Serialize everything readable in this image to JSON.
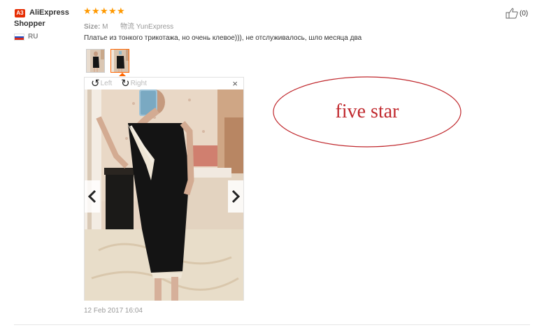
{
  "user": {
    "badge": "A3",
    "name_line1": "AliExpress",
    "name_line2": "Shopper",
    "country": "RU"
  },
  "rating": {
    "stars": 5,
    "max": 5,
    "color": "#ff9900"
  },
  "meta": {
    "size_label": "Size:",
    "size_value": "M",
    "shipping_value": "物流 YunExpress"
  },
  "review": {
    "text": "Платье из тонкого трикотажа, но очень клевое))), не отслуживалось, шло месяца два",
    "date": "12 Feb 2017 16:04"
  },
  "viewer": {
    "rotate_left_label": "Left",
    "rotate_right_label": "Right",
    "close_label": "×",
    "prev_icon": "chevron-left-icon",
    "next_icon": "chevron-right-icon"
  },
  "helpful": {
    "count": "(0)",
    "icon": "thumbs-up-icon"
  },
  "annotation": {
    "text": "five star",
    "color": "#c0282d"
  },
  "colors": {
    "brand": "#e62e04",
    "accent": "#ff6600"
  }
}
